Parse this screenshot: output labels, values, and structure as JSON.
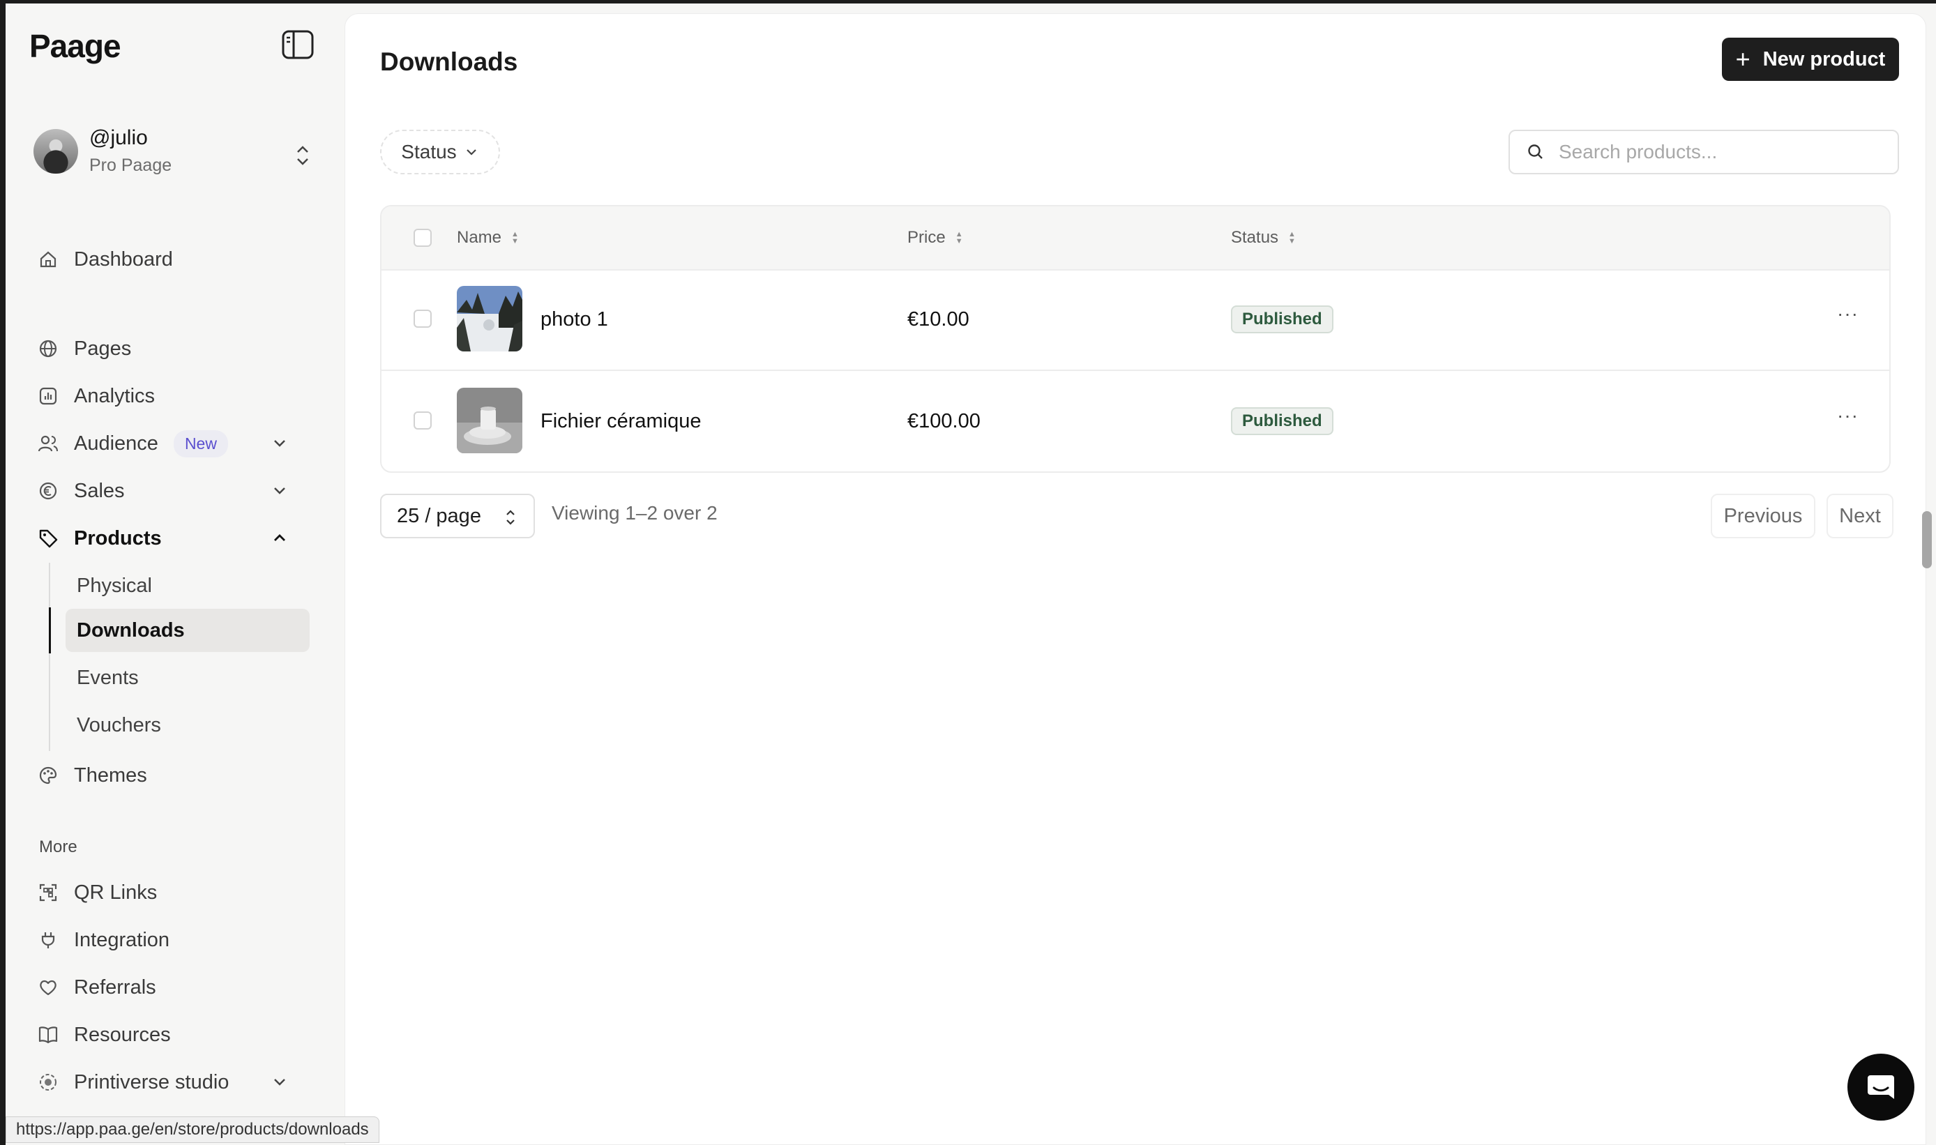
{
  "app": {
    "logo": "Paage"
  },
  "profile": {
    "handle": "@julio",
    "plan": "Pro Paage"
  },
  "sidebar": {
    "dashboard": "Dashboard",
    "pages": "Pages",
    "analytics": "Analytics",
    "audience": "Audience",
    "audience_badge": "New",
    "sales": "Sales",
    "products": "Products",
    "products_sub": [
      "Physical",
      "Downloads",
      "Events",
      "Vouchers"
    ],
    "themes": "Themes",
    "more_label": "More",
    "qr_links": "QR Links",
    "integration": "Integration",
    "referrals": "Referrals",
    "resources": "Resources",
    "printiverse": "Printiverse studio"
  },
  "main": {
    "title": "Downloads",
    "new_button": "New product",
    "status_filter": "Status",
    "search_placeholder": "Search products...",
    "columns": {
      "name": "Name",
      "price": "Price",
      "status": "Status"
    },
    "rows": [
      {
        "name": "photo 1",
        "price": "€10.00",
        "status": "Published",
        "menu": "···"
      },
      {
        "name": "Fichier céramique",
        "price": "€100.00",
        "status": "Published",
        "menu": "···"
      }
    ],
    "page_size": "25 / page",
    "viewing": "Viewing 1–2 over 2",
    "previous": "Previous",
    "next": "Next"
  },
  "status_bar": {
    "url": "https://app.paa.ge/en/store/products/downloads"
  },
  "colors": {
    "accent": "#1e1e1e",
    "badge_new": "#5b4fcf",
    "published": "#2d5a3e"
  }
}
